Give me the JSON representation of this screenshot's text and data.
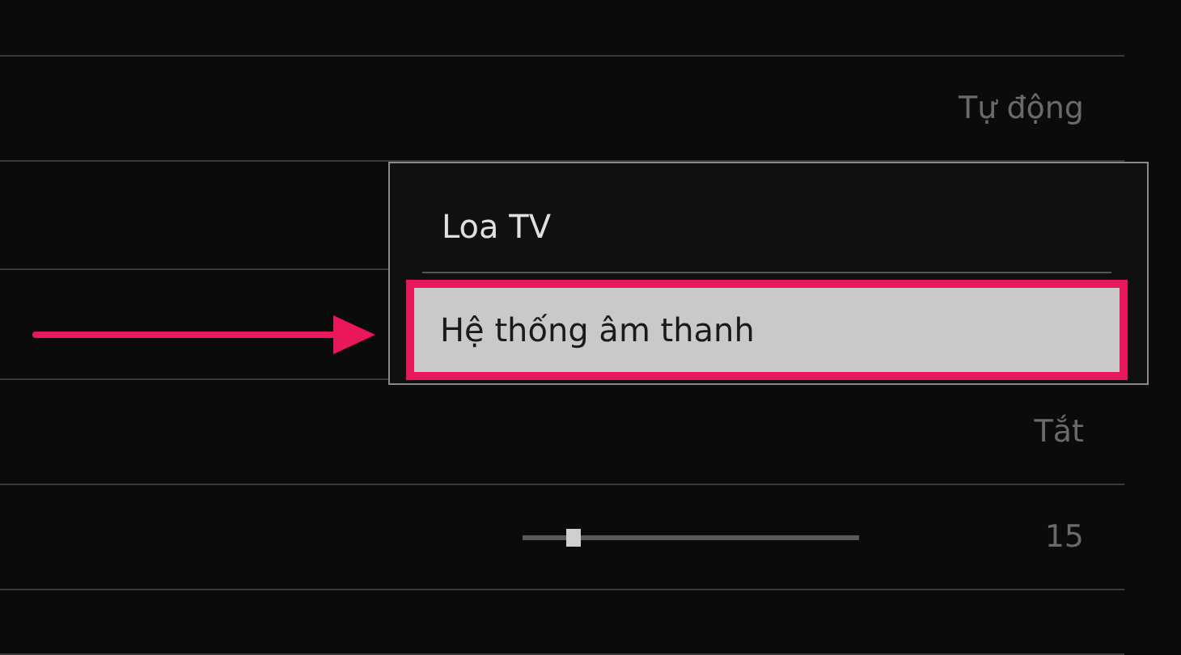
{
  "settings_rows": [
    {
      "kind": "blank"
    },
    {
      "kind": "value",
      "value": "Tự động"
    },
    {
      "kind": "blank"
    },
    {
      "kind": "blank"
    },
    {
      "kind": "value",
      "value": "Tắt"
    },
    {
      "kind": "slider",
      "level": 0.15,
      "reading": "15"
    },
    {
      "kind": "blank"
    }
  ],
  "popup_menu": {
    "items": [
      {
        "label": "Loa TV",
        "selected": false
      },
      {
        "label": "Hệ thống âm thanh",
        "selected": true
      }
    ]
  }
}
